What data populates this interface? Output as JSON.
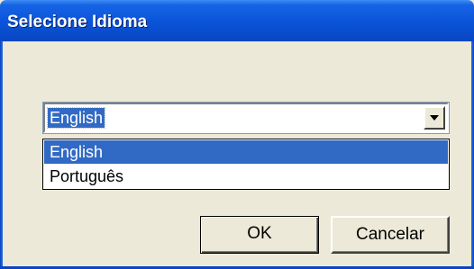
{
  "window": {
    "title": "Selecione Idioma"
  },
  "language_combo": {
    "selected_value": "English",
    "arrow_icon": "dropdown-arrow-icon"
  },
  "language_list": {
    "options": [
      "English",
      "Português"
    ],
    "highlighted_index": 0
  },
  "buttons": {
    "ok_label": "OK",
    "cancel_label": "Cancelar"
  },
  "colors": {
    "titlebar": "#0a53d8",
    "selection": "#316ac5",
    "dialog_background": "#ece9d8"
  }
}
